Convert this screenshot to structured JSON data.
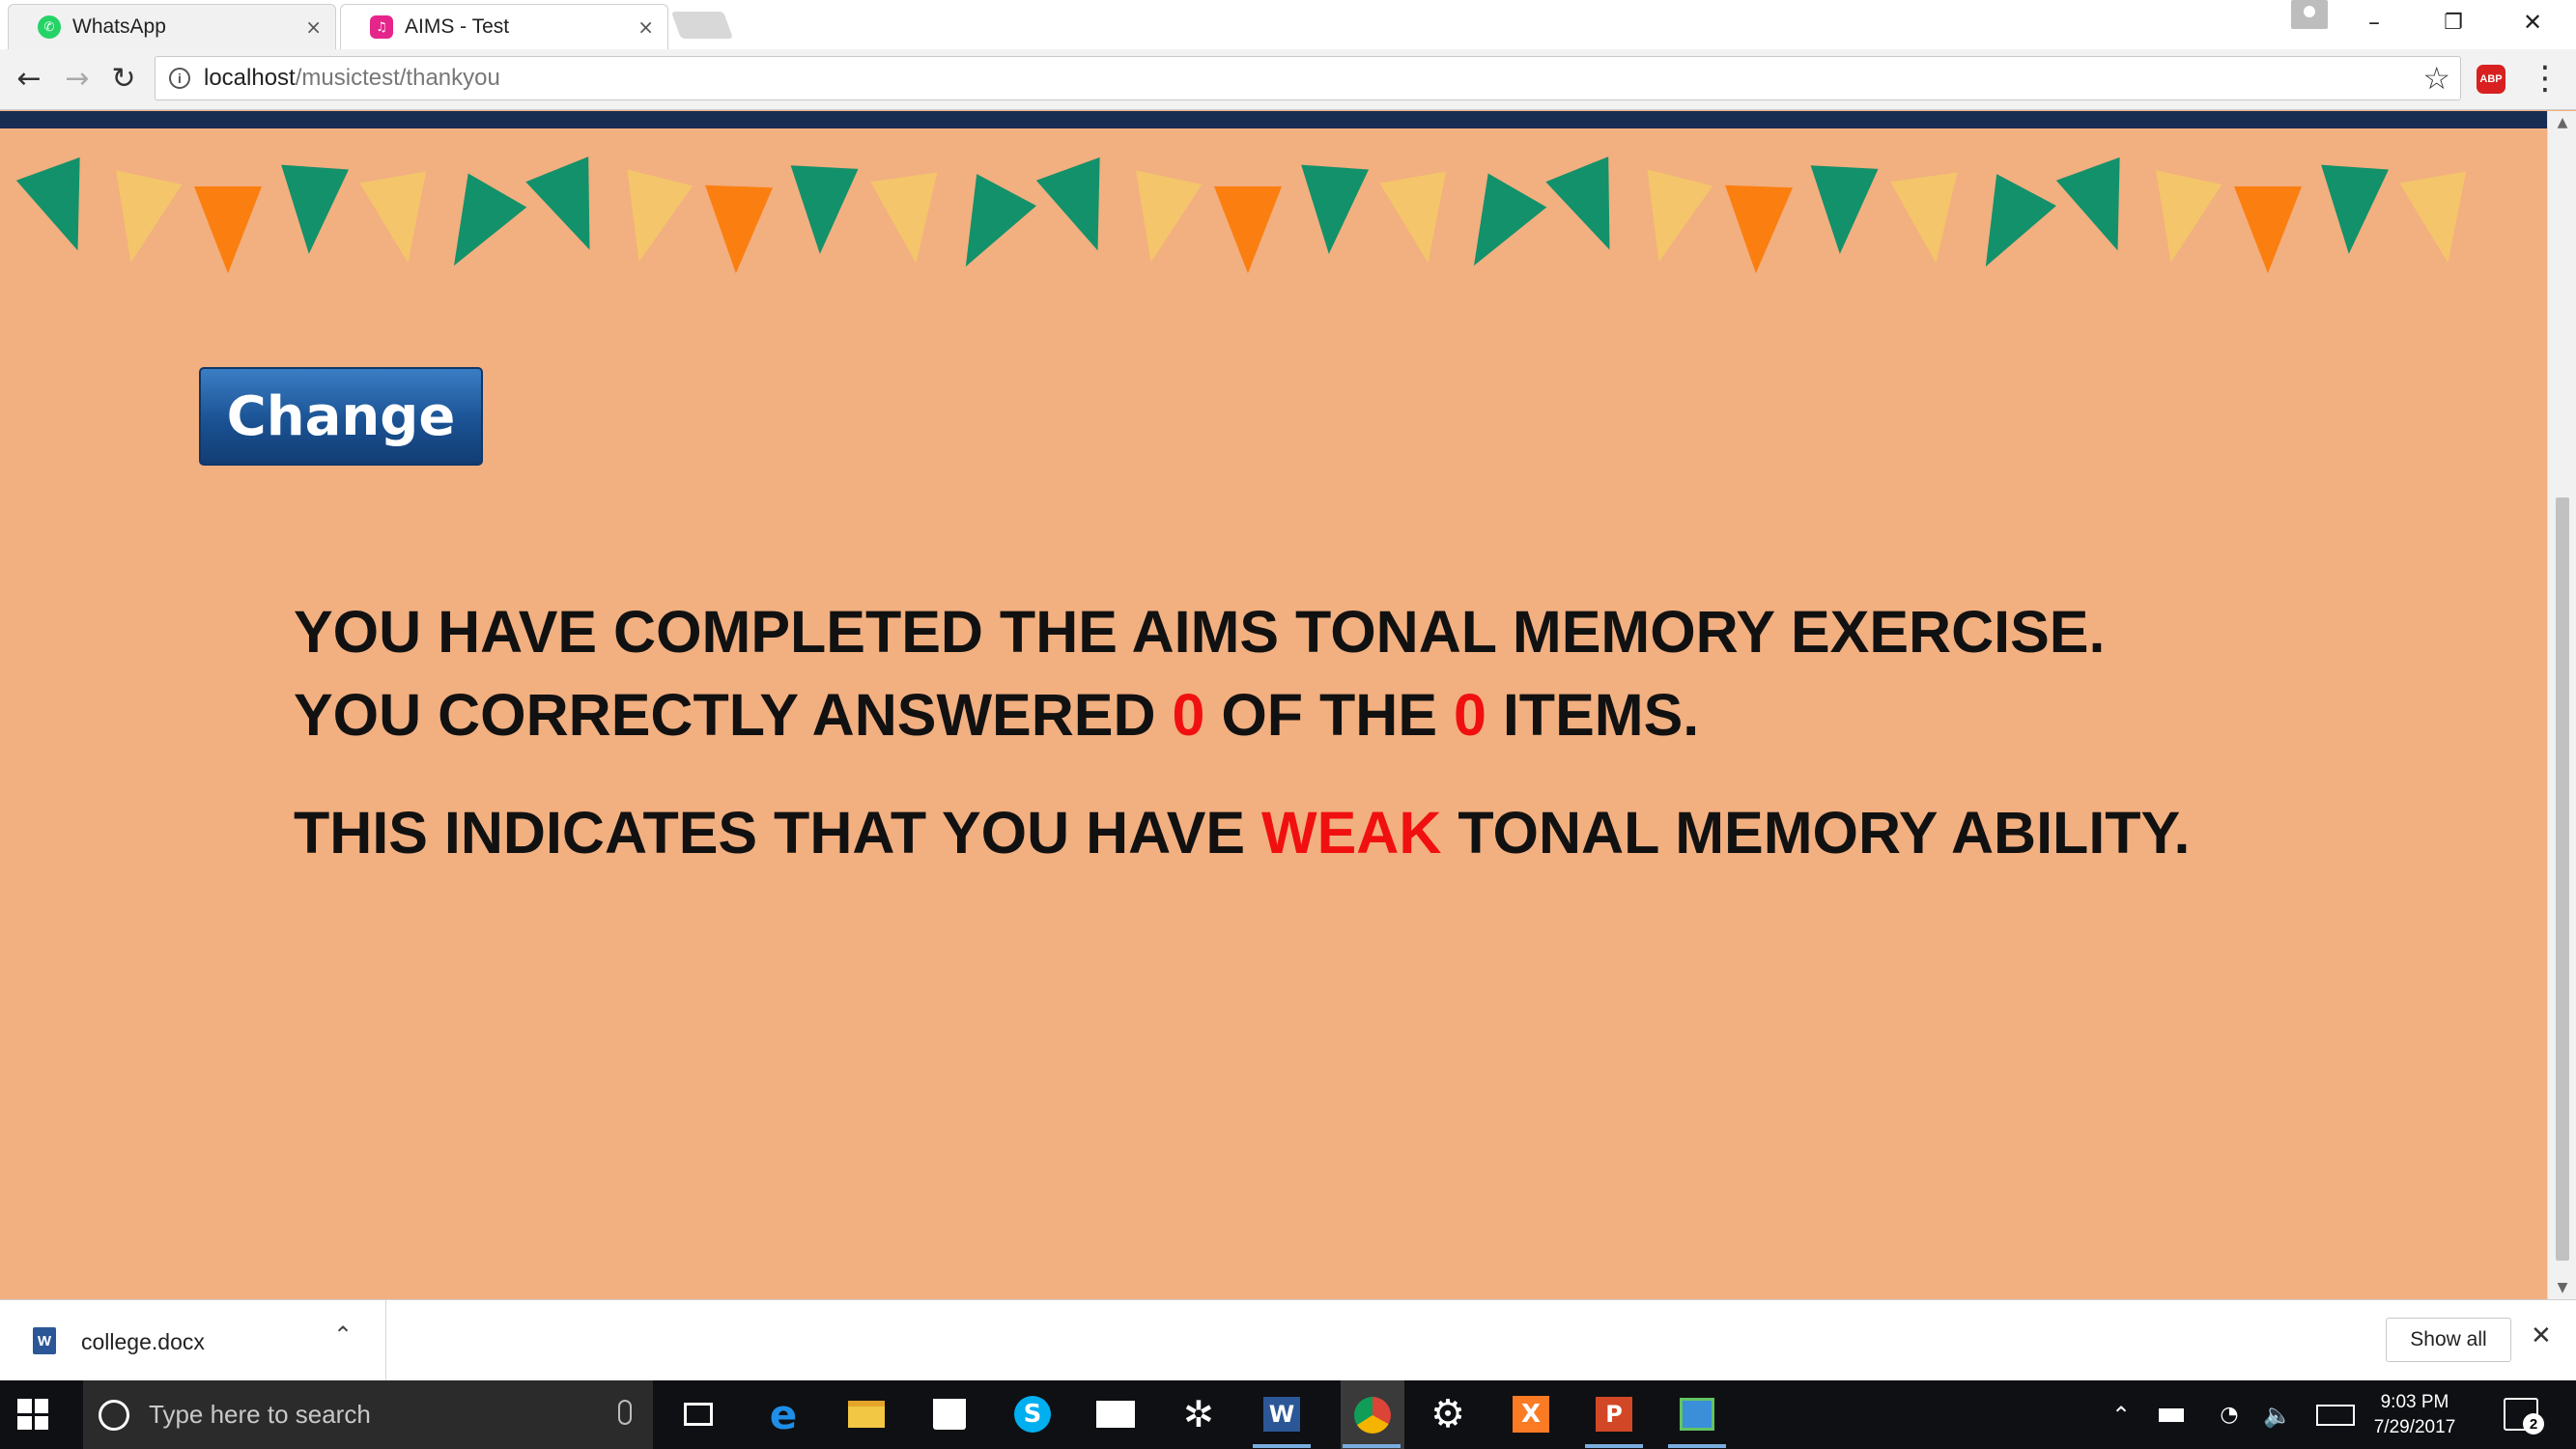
{
  "browser": {
    "tabs": [
      {
        "label": "WhatsApp",
        "favicon_color": "#25d366"
      },
      {
        "label": "AIMS - Test",
        "favicon_color": "#e5258a"
      }
    ],
    "address": {
      "host": "localhost",
      "path": "/musictest/thankyou"
    },
    "abp_label": "ABP"
  },
  "page": {
    "banner_colors": [
      "#13916a",
      "#f4c56b",
      "#fb7f10"
    ],
    "change_label": "Change",
    "result": {
      "line1": "YOU HAVE COMPLETED THE AIMS TONAL MEMORY EXERCISE.",
      "line2_prefix": "YOU CORRECTLY ANSWERED ",
      "correct_count": "0",
      "line2_mid": " OF THE ",
      "total_count": "0",
      "line2_suffix": " ITEMS.",
      "line3_prefix": "THIS INDICATES THAT YOU HAVE ",
      "ability": "WEAK",
      "line3_suffix": " TONAL MEMORY ABILITY."
    }
  },
  "downloads": {
    "file_name": "college.docx",
    "show_all_label": "Show all"
  },
  "taskbar": {
    "search_placeholder": "Type here to search",
    "time": "9:03 PM",
    "date": "7/29/2017",
    "notification_count": "2"
  }
}
